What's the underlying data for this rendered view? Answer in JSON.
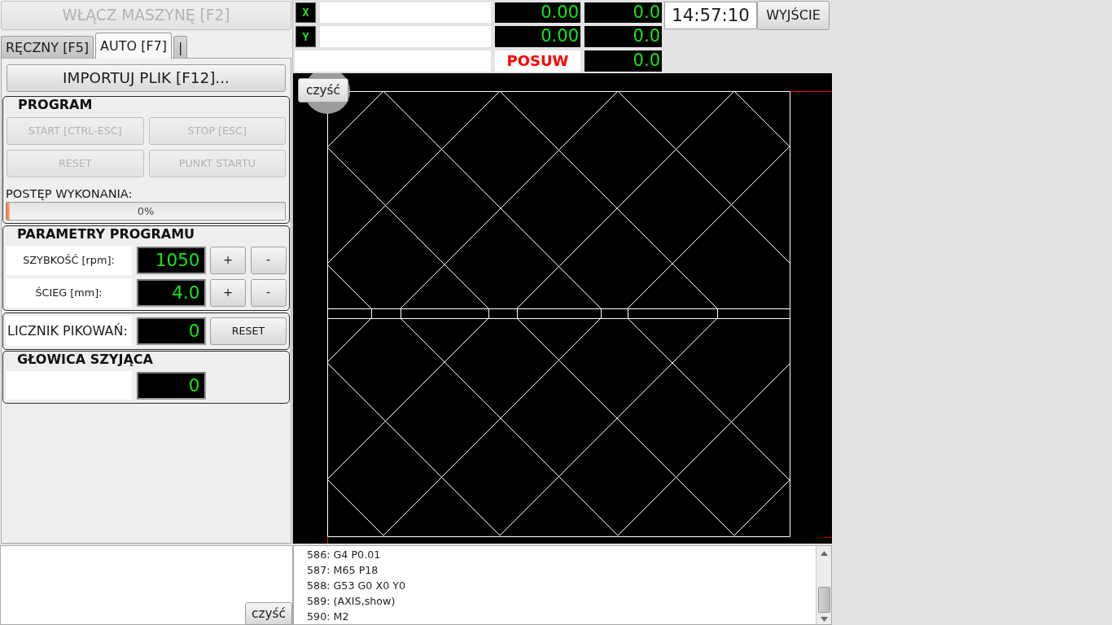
{
  "power_button": {
    "label": "WŁĄCZ MASZYNĘ [F2]",
    "disabled": true
  },
  "tabs": [
    {
      "label": "RĘCZNY [F5]",
      "selected": false
    },
    {
      "label": "AUTO [F7]",
      "selected": true
    },
    {
      "label": "|",
      "selected": false
    }
  ],
  "import_button": {
    "label": "IMPORTUJ PLIK [F12]..."
  },
  "program": {
    "title": "PROGRAM",
    "buttons": [
      {
        "label": "START [CTRL-ESC]",
        "disabled": true
      },
      {
        "label": "STOP [ESC]",
        "disabled": true
      },
      {
        "label": "RESET",
        "disabled": true
      },
      {
        "label": "PUNKT STARTU",
        "disabled": true
      }
    ],
    "progress_label": "POSTĘP WYKONANIA:",
    "progress": {
      "level": 0,
      "text": "0%"
    }
  },
  "parameters": {
    "title": "PARAMETRY PROGRAMU",
    "rows": [
      {
        "label": "SZYBKOŚĆ [rpm]:",
        "value": "1050",
        "increase": "+",
        "decrease": "-"
      },
      {
        "label": "ŚCIEG [mm]:",
        "value": "4.0",
        "increase": "+",
        "decrease": "-"
      }
    ]
  },
  "counter": {
    "label": "LICZNIK PIKOWAŃ:",
    "value": "0",
    "reset_button": "RESET"
  },
  "sewing_head": {
    "title": "GŁOWICA SZYJĄCA",
    "value": "0"
  },
  "axes": [
    {
      "name": "X",
      "value": "0.00",
      "value_2": "0.0"
    },
    {
      "name": "Y",
      "value": "0.00",
      "value_2": "0.0"
    }
  ],
  "feed": {
    "label": "POSUW",
    "value": "0.0"
  },
  "clock": "14:57:10",
  "exit_button": "WYJŚCIE",
  "preview": {
    "clear_button": "czyść"
  },
  "console": {
    "clear_button": "czyść"
  },
  "gcode_listing": [
    "586: G4 P0.01",
    "587: M65 P18",
    "588: G53 G0 X0 Y0",
    "589: (AXIS,show)",
    "590: M2"
  ]
}
